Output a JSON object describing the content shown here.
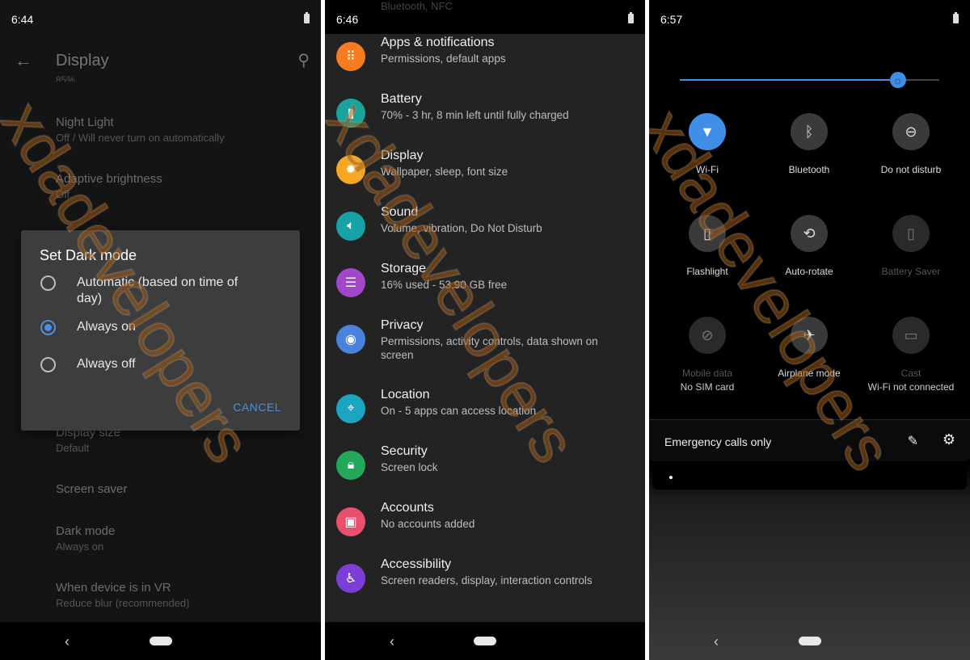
{
  "watermark": "xdadevelopers",
  "colors": {
    "accent": "#4a90e2",
    "qs_active": "#3f8ee8"
  },
  "screen1": {
    "time": "6:44",
    "title": "Display",
    "back_icon": "arrow-left-icon",
    "search_icon": "search-icon",
    "cutoff_text": "85%",
    "items": [
      {
        "title": "Night Light",
        "subtitle": "Off / Will never turn on automatically"
      },
      {
        "title": "Adaptive brightness",
        "subtitle": "Off"
      },
      {
        "title": "Display size",
        "subtitle": "Default"
      },
      {
        "title": "Screen saver",
        "subtitle": ""
      },
      {
        "title": "Dark mode",
        "subtitle": "Always on"
      },
      {
        "title": "When device is in VR",
        "subtitle": "Reduce blur (recommended)"
      }
    ],
    "dialog": {
      "title": "Set Dark mode",
      "options": [
        {
          "label": "Automatic (based on time of day)",
          "selected": false
        },
        {
          "label": "Always on",
          "selected": true
        },
        {
          "label": "Always off",
          "selected": false
        }
      ],
      "cancel": "CANCEL"
    }
  },
  "screen2": {
    "time": "6:46",
    "cutoff_text": "Bluetooth, NFC",
    "items": [
      {
        "title": "Apps & notifications",
        "subtitle": "Permissions, default apps",
        "icon": "apps-grid-icon",
        "color": "#f57c1f"
      },
      {
        "title": "Battery",
        "subtitle": "70% - 3 hr, 8 min left until fully charged",
        "icon": "battery-icon",
        "color": "#1aa39a"
      },
      {
        "title": "Display",
        "subtitle": "Wallpaper, sleep, font size",
        "icon": "brightness-icon",
        "color": "#f5a623"
      },
      {
        "title": "Sound",
        "subtitle": "Volume, vibration, Do Not Disturb",
        "icon": "volume-icon",
        "color": "#17a2a8"
      },
      {
        "title": "Storage",
        "subtitle": "16% used - 53.90 GB free",
        "icon": "storage-icon",
        "color": "#a347c9"
      },
      {
        "title": "Privacy",
        "subtitle": "Permissions, activity controls, data shown on screen",
        "icon": "eye-icon",
        "color": "#4b83dc"
      },
      {
        "title": "Location",
        "subtitle": "On - 5 apps can access location",
        "icon": "location-pin-icon",
        "color": "#1ba5c0"
      },
      {
        "title": "Security",
        "subtitle": "Screen lock",
        "icon": "lock-icon",
        "color": "#23a85a"
      },
      {
        "title": "Accounts",
        "subtitle": "No accounts added",
        "icon": "account-icon",
        "color": "#e8506c"
      },
      {
        "title": "Accessibility",
        "subtitle": "Screen readers, display, interaction controls",
        "icon": "accessibility-icon",
        "color": "#7b3fd6"
      }
    ]
  },
  "screen3": {
    "time": "6:57",
    "brightness_percent": 84,
    "tiles": [
      {
        "label": "Wi-Fi",
        "sub": "",
        "icon": "wifi-icon",
        "state": "on"
      },
      {
        "label": "Bluetooth",
        "sub": "",
        "icon": "bluetooth-icon",
        "state": "off"
      },
      {
        "label": "Do not disturb",
        "sub": "",
        "icon": "do-not-disturb-icon",
        "state": "off"
      },
      {
        "label": "Flashlight",
        "sub": "",
        "icon": "flashlight-icon",
        "state": "off"
      },
      {
        "label": "Auto-rotate",
        "sub": "",
        "icon": "auto-rotate-icon",
        "state": "off"
      },
      {
        "label": "Battery Saver",
        "sub": "",
        "icon": "battery-saver-icon",
        "state": "unavailable"
      },
      {
        "label": "Mobile data",
        "sub": "No SIM card",
        "icon": "no-sim-icon",
        "state": "unavailable"
      },
      {
        "label": "Airplane mode",
        "sub": "",
        "icon": "airplane-icon",
        "state": "off"
      },
      {
        "label": "Cast",
        "sub": "Wi-Fi not connected",
        "icon": "cast-icon",
        "state": "unavailable"
      }
    ],
    "footer": "Emergency calls only"
  }
}
